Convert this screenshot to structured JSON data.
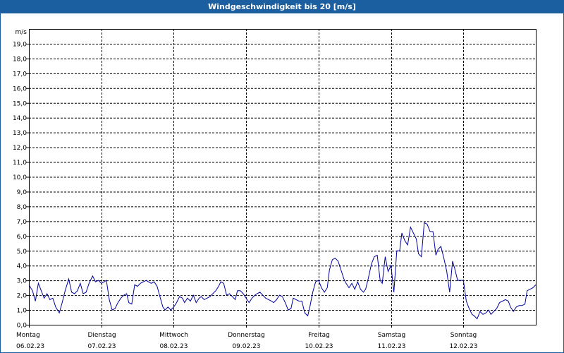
{
  "window": {
    "title": "Windgeschwindigkeit bis 20 [m/s]"
  },
  "colors": {
    "title_bar": "#1b5fa0",
    "line": "#0000a0",
    "grid": "#000000"
  },
  "chart_data": {
    "type": "line",
    "title": "Windgeschwindigkeit bis 20 [m/s]",
    "ylabel": "m/s",
    "xlabel": "",
    "ylim": [
      0,
      20
    ],
    "xlim": [
      0,
      7
    ],
    "grid": true,
    "y_ticks": [
      "0,0",
      "1,0",
      "2,0",
      "3,0",
      "4,0",
      "5,0",
      "6,0",
      "7,0",
      "8,0",
      "9,0",
      "10,0",
      "11,0",
      "12,0",
      "13,0",
      "14,0",
      "15,0",
      "16,0",
      "17,0",
      "18,0",
      "19,0"
    ],
    "x_ticks": [
      {
        "day": "Montag",
        "date": "06.02.23"
      },
      {
        "day": "Dienstag",
        "date": "07.02.23"
      },
      {
        "day": "Mittwoch",
        "date": "08.02.23"
      },
      {
        "day": "Donnerstag",
        "date": "09.02.23"
      },
      {
        "day": "Freitag",
        "date": "10.02.23"
      },
      {
        "day": "Samstag",
        "date": "11.02.23"
      },
      {
        "day": "Sonntag",
        "date": "12.02.23"
      }
    ],
    "series": [
      {
        "values": [
          [
            0.0,
            2.7
          ],
          [
            0.05,
            2.3
          ],
          [
            0.09,
            1.6
          ],
          [
            0.13,
            2.8
          ],
          [
            0.17,
            2.3
          ],
          [
            0.21,
            1.8
          ],
          [
            0.25,
            2.1
          ],
          [
            0.29,
            1.7
          ],
          [
            0.33,
            1.8
          ],
          [
            0.37,
            1.2
          ],
          [
            0.42,
            0.8
          ],
          [
            0.46,
            1.5
          ],
          [
            0.5,
            2.3
          ],
          [
            0.55,
            3.1
          ],
          [
            0.59,
            2.2
          ],
          [
            0.63,
            2.1
          ],
          [
            0.67,
            2.3
          ],
          [
            0.71,
            2.8
          ],
          [
            0.75,
            2.1
          ],
          [
            0.79,
            2.2
          ],
          [
            0.83,
            2.8
          ],
          [
            0.88,
            3.3
          ],
          [
            0.92,
            2.9
          ],
          [
            0.96,
            3.0
          ],
          [
            1.0,
            2.8
          ],
          [
            1.04,
            2.9
          ],
          [
            1.07,
            3.0
          ],
          [
            1.11,
            1.7
          ],
          [
            1.15,
            1.0
          ],
          [
            1.19,
            1.1
          ],
          [
            1.23,
            1.5
          ],
          [
            1.27,
            1.8
          ],
          [
            1.31,
            2.0
          ],
          [
            1.35,
            2.1
          ],
          [
            1.38,
            1.5
          ],
          [
            1.42,
            1.4
          ],
          [
            1.46,
            2.7
          ],
          [
            1.5,
            2.6
          ],
          [
            1.54,
            2.8
          ],
          [
            1.58,
            2.9
          ],
          [
            1.62,
            3.0
          ],
          [
            1.65,
            2.9
          ],
          [
            1.69,
            2.8
          ],
          [
            1.73,
            2.9
          ],
          [
            1.77,
            2.6
          ],
          [
            1.81,
            1.9
          ],
          [
            1.85,
            1.2
          ],
          [
            1.88,
            1.0
          ],
          [
            1.92,
            1.2
          ],
          [
            1.96,
            1.0
          ],
          [
            2.0,
            1.2
          ],
          [
            2.04,
            1.5
          ],
          [
            2.08,
            1.9
          ],
          [
            2.12,
            1.8
          ],
          [
            2.15,
            1.5
          ],
          [
            2.19,
            1.8
          ],
          [
            2.23,
            1.6
          ],
          [
            2.27,
            2.0
          ],
          [
            2.31,
            1.5
          ],
          [
            2.35,
            1.8
          ],
          [
            2.38,
            1.9
          ],
          [
            2.42,
            1.7
          ],
          [
            2.46,
            1.8
          ],
          [
            2.5,
            1.9
          ],
          [
            2.54,
            2.1
          ],
          [
            2.58,
            2.3
          ],
          [
            2.62,
            2.6
          ],
          [
            2.65,
            2.9
          ],
          [
            2.69,
            2.8
          ],
          [
            2.73,
            2.0
          ],
          [
            2.77,
            2.1
          ],
          [
            2.81,
            1.9
          ],
          [
            2.85,
            1.7
          ],
          [
            2.88,
            2.3
          ],
          [
            2.92,
            2.3
          ],
          [
            2.96,
            2.1
          ],
          [
            3.0,
            1.8
          ],
          [
            3.04,
            1.5
          ],
          [
            3.08,
            1.8
          ],
          [
            3.12,
            2.0
          ],
          [
            3.15,
            2.1
          ],
          [
            3.19,
            2.2
          ],
          [
            3.23,
            2.0
          ],
          [
            3.27,
            1.8
          ],
          [
            3.31,
            1.7
          ],
          [
            3.35,
            1.6
          ],
          [
            3.38,
            1.5
          ],
          [
            3.42,
            1.7
          ],
          [
            3.46,
            2.0
          ],
          [
            3.5,
            1.9
          ],
          [
            3.54,
            1.5
          ],
          [
            3.58,
            1.0
          ],
          [
            3.62,
            1.1
          ],
          [
            3.65,
            1.8
          ],
          [
            3.69,
            1.7
          ],
          [
            3.73,
            1.6
          ],
          [
            3.77,
            1.6
          ],
          [
            3.81,
            0.8
          ],
          [
            3.85,
            0.6
          ],
          [
            3.88,
            1.2
          ],
          [
            3.92,
            2.2
          ],
          [
            3.96,
            2.9
          ],
          [
            4.0,
            3.0
          ],
          [
            4.04,
            2.5
          ],
          [
            4.08,
            2.2
          ],
          [
            4.12,
            2.5
          ],
          [
            4.15,
            3.7
          ],
          [
            4.19,
            4.4
          ],
          [
            4.23,
            4.5
          ],
          [
            4.27,
            4.3
          ],
          [
            4.31,
            3.7
          ],
          [
            4.35,
            3.1
          ],
          [
            4.38,
            2.8
          ],
          [
            4.42,
            2.5
          ],
          [
            4.46,
            2.8
          ],
          [
            4.5,
            2.4
          ],
          [
            4.54,
            2.9
          ],
          [
            4.58,
            2.4
          ],
          [
            4.62,
            2.2
          ],
          [
            4.65,
            2.4
          ],
          [
            4.69,
            3.2
          ],
          [
            4.73,
            4.1
          ],
          [
            4.77,
            4.6
          ],
          [
            4.81,
            4.7
          ],
          [
            4.85,
            3.0
          ],
          [
            4.88,
            2.8
          ],
          [
            4.92,
            4.6
          ],
          [
            4.96,
            3.6
          ],
          [
            5.0,
            4.0
          ],
          [
            5.04,
            2.2
          ],
          [
            5.08,
            5.0
          ],
          [
            5.12,
            5.0
          ],
          [
            5.15,
            6.2
          ],
          [
            5.19,
            5.7
          ],
          [
            5.23,
            5.4
          ],
          [
            5.27,
            6.6
          ],
          [
            5.31,
            6.2
          ],
          [
            5.35,
            5.8
          ],
          [
            5.38,
            4.8
          ],
          [
            5.42,
            4.6
          ],
          [
            5.46,
            6.9
          ],
          [
            5.5,
            6.8
          ],
          [
            5.54,
            6.3
          ],
          [
            5.58,
            6.3
          ],
          [
            5.62,
            4.7
          ],
          [
            5.65,
            5.1
          ],
          [
            5.69,
            5.3
          ],
          [
            5.73,
            4.5
          ],
          [
            5.77,
            3.6
          ],
          [
            5.81,
            2.2
          ],
          [
            5.85,
            4.3
          ],
          [
            5.88,
            3.8
          ],
          [
            5.92,
            3.0
          ],
          [
            5.96,
            3.0
          ],
          [
            6.0,
            3.0
          ],
          [
            6.04,
            1.6
          ],
          [
            6.08,
            1.1
          ],
          [
            6.12,
            0.7
          ],
          [
            6.15,
            0.6
          ],
          [
            6.19,
            0.4
          ],
          [
            6.23,
            0.9
          ],
          [
            6.27,
            0.7
          ],
          [
            6.31,
            0.8
          ],
          [
            6.35,
            1.0
          ],
          [
            6.38,
            0.7
          ],
          [
            6.42,
            0.9
          ],
          [
            6.46,
            1.1
          ],
          [
            6.5,
            1.5
          ],
          [
            6.54,
            1.6
          ],
          [
            6.58,
            1.7
          ],
          [
            6.62,
            1.6
          ],
          [
            6.65,
            1.2
          ],
          [
            6.69,
            0.9
          ],
          [
            6.73,
            1.2
          ],
          [
            6.77,
            1.3
          ],
          [
            6.81,
            1.3
          ],
          [
            6.85,
            1.4
          ],
          [
            6.88,
            2.3
          ],
          [
            6.92,
            2.4
          ],
          [
            6.96,
            2.5
          ],
          [
            7.0,
            2.7
          ]
        ]
      }
    ]
  }
}
